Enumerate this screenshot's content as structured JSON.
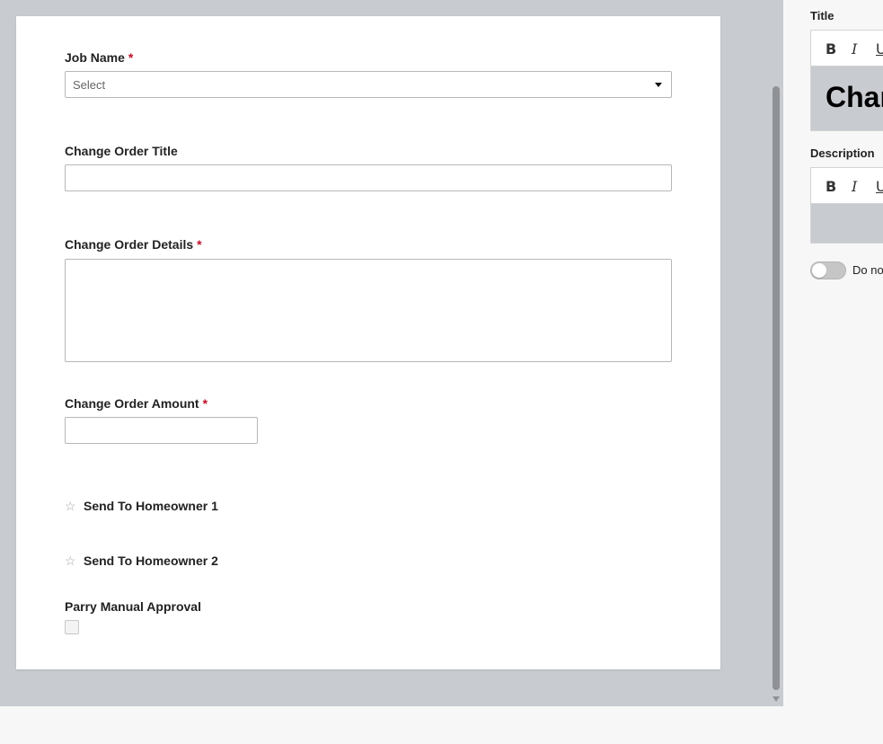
{
  "form": {
    "job_name": {
      "label": "Job Name",
      "required_mark": "*",
      "placeholder": "Select"
    },
    "change_order_title": {
      "label": "Change Order Title",
      "value": ""
    },
    "change_order_details": {
      "label": "Change Order Details",
      "required_mark": "*",
      "value": ""
    },
    "change_order_amount": {
      "label": "Change Order Amount",
      "required_mark": "*",
      "value": ""
    },
    "send_to_homeowner_1": {
      "label": "Send To Homeowner 1",
      "icon": "star-outline-icon"
    },
    "send_to_homeowner_2": {
      "label": "Send To Homeowner 2",
      "icon": "star-outline-icon"
    },
    "parry_manual_approval": {
      "label": "Parry Manual Approval",
      "checked": false
    }
  },
  "panel": {
    "title_label": "Title",
    "title_value": "Chan",
    "description_label": "Description",
    "toolbar": {
      "bold": "B",
      "italic": "I",
      "underline": "U"
    },
    "toggle_label": "Do no",
    "toggle_on": false
  },
  "colors": {
    "canvas_bg": "#c8cbd0",
    "required": "#c0102a",
    "panel_bg": "#f7f7f7"
  }
}
